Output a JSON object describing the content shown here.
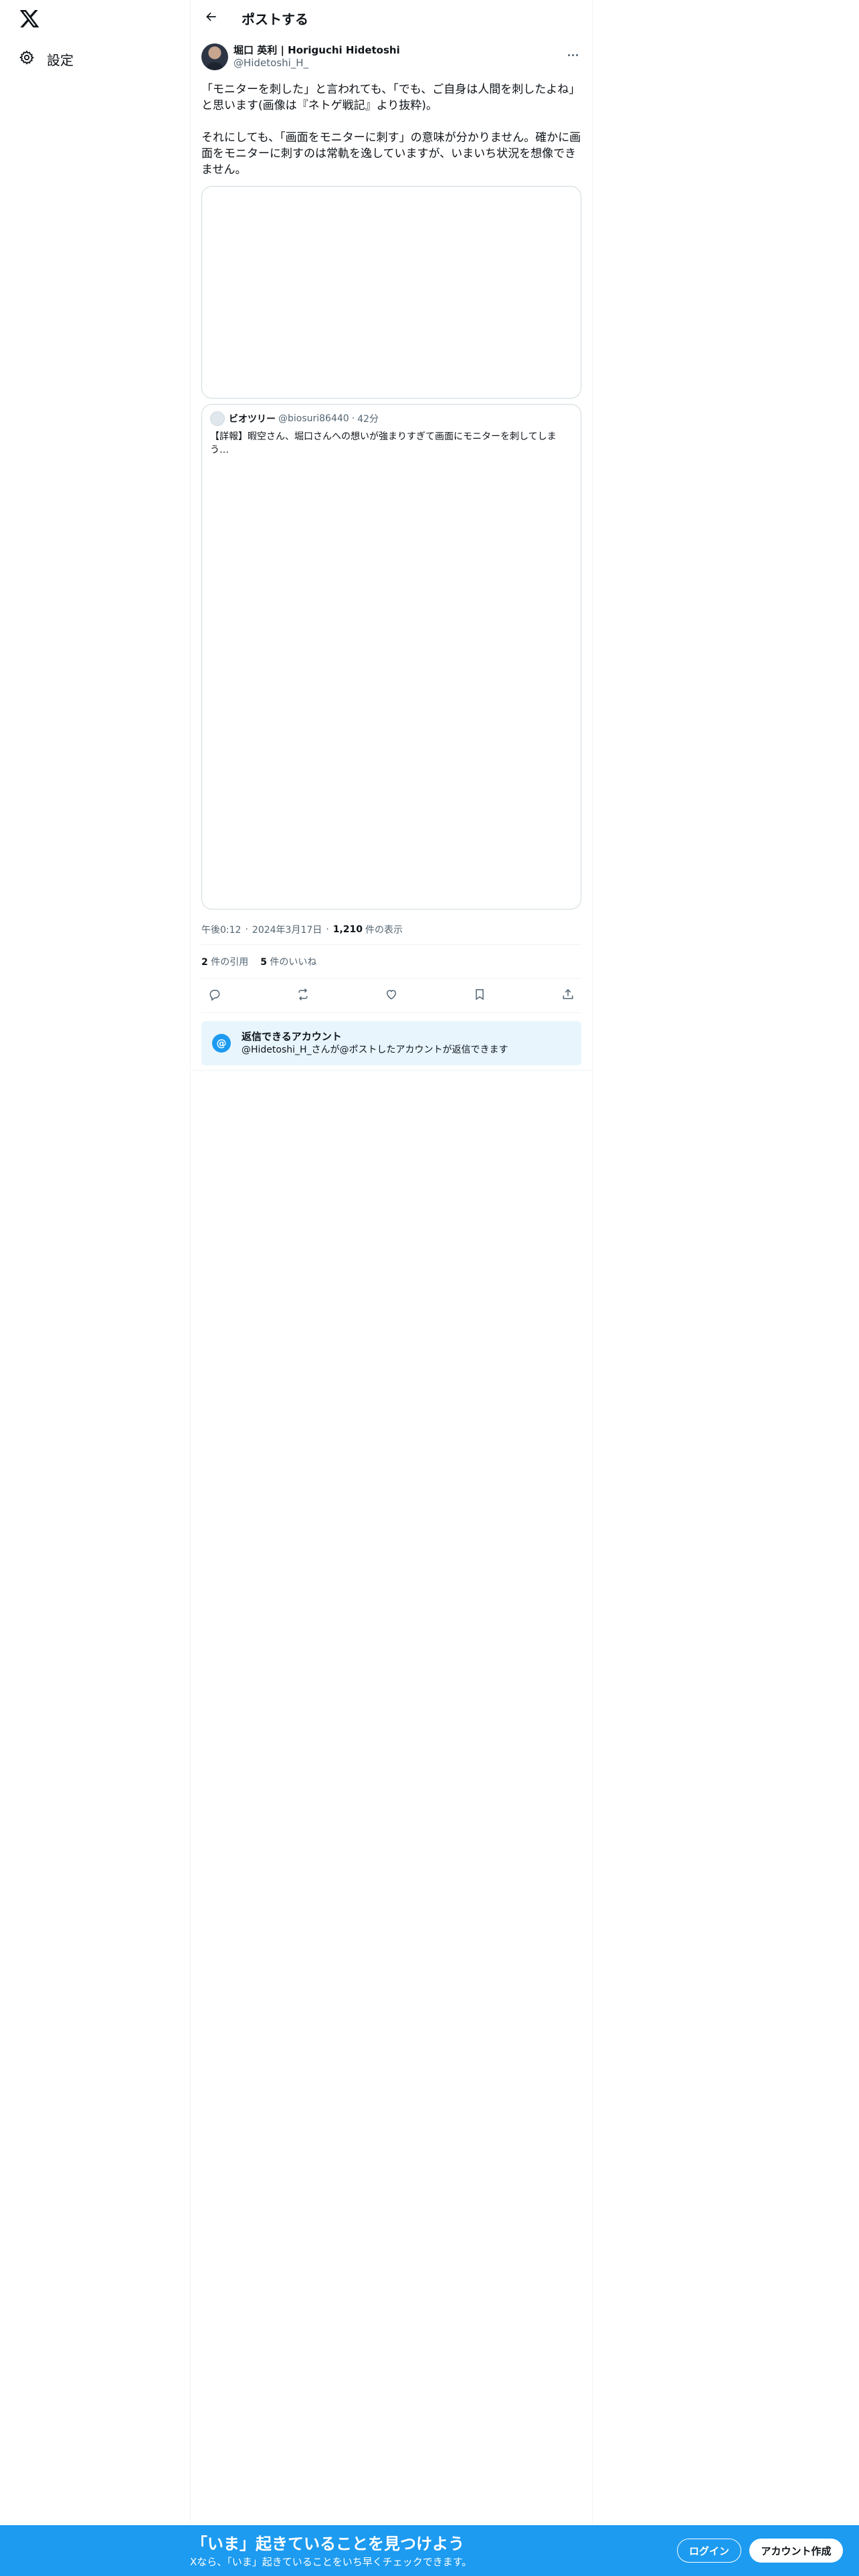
{
  "nav": {
    "logo_icon": "x-logo-icon",
    "settings_label": "設定"
  },
  "header": {
    "title": "ポストする"
  },
  "post": {
    "author_name": "堀口 英利 | Horiguchi Hidetoshi",
    "author_handle": "@Hidetoshi_H_",
    "text": "「モニターを刺した」と言われても、「でも、ご自身は人間を刺したよね」と思います(画像は『ネトゲ戦記』より抜粋)。\n\nそれにしても、「画面をモニターに刺す」の意味が分かりません。確かに画面をモニターに刺すのは常軌を逸していますが、いまいち状況を想像できません。",
    "time": "午後0:12",
    "date": "2024年3月17日",
    "views_count": "1,210",
    "views_label": "件の表示",
    "quotes_count": "2",
    "quotes_label": "件の引用",
    "likes_count": "5",
    "likes_label": "件のいいね"
  },
  "quote": {
    "name": "ビオツリー",
    "handle": "@biosuri86440",
    "time": "42分",
    "text": "【詳報】暇空さん、堀口さんへの想いが強まりすぎて画面にモニターを刺してしまう…"
  },
  "reply_note": {
    "title": "返信できるアカウント",
    "subtitle": "@Hidetoshi_H_さんが@ポストしたアカウントが返信できます"
  },
  "banner": {
    "title": "「いま」起きていることを見つけよう",
    "subtitle": "Xなら、「いま」起きていることをいち早くチェックできます。",
    "login_label": "ログイン",
    "signup_label": "アカウント作成"
  },
  "colors": {
    "accent": "#1d9bf0",
    "text": "#0f1419",
    "muted": "#536471",
    "border": "#cfd9de",
    "reply_bg": "#e8f5fd"
  }
}
